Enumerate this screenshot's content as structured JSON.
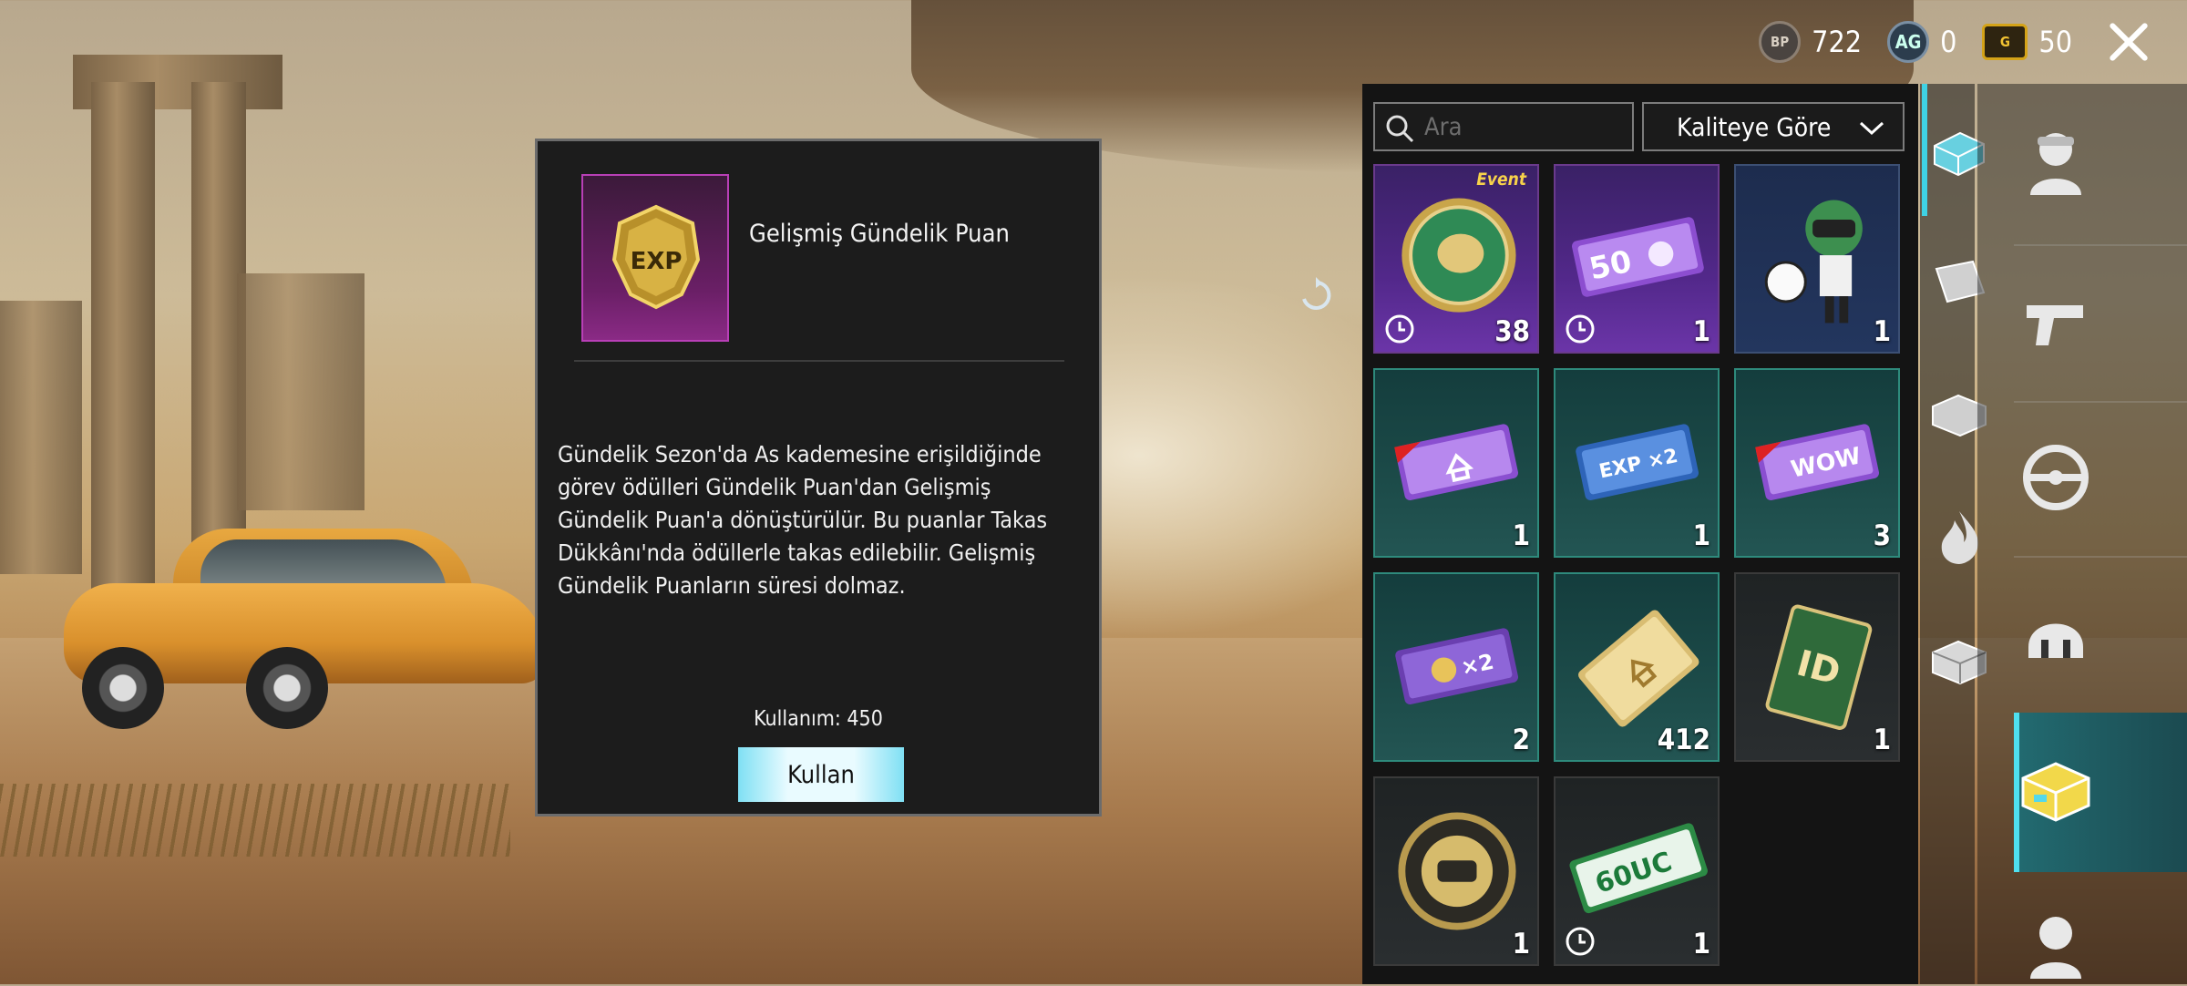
{
  "currency": {
    "bp_label": "BP",
    "bp_value": "722",
    "silver_label": "AG",
    "silver_value": "0",
    "gold_label": "G",
    "gold_value": "50"
  },
  "detail": {
    "title": "Gelişmiş Gündelik Puan",
    "icon_text": "EXP",
    "description": "Gündelik Sezon'da As kademesine erişildiğinde görev ödülleri Gündelik Puan'dan Gelişmiş Gündelik Puan'a dönüştürülür. Bu puanlar Takas Dükkânı'nda ödüllerle takas edilebilir. Gelişmiş Gündelik Puanların süresi dolmaz.",
    "usage": "Kullanım: 450",
    "use_button": "Kullan"
  },
  "inventory": {
    "search_placeholder": "Ara",
    "sort_label": "Kaliteye Göre",
    "items": [
      {
        "name": "event-coin",
        "qty": "38",
        "timed": true,
        "tag": "Event",
        "icon": "sheep-coin-icon"
      },
      {
        "name": "paw-voucher",
        "qty": "1",
        "timed": true,
        "icon_text": "50",
        "icon": "paw-voucher-icon"
      },
      {
        "name": "football-character",
        "qty": "1",
        "icon": "soccer-character-icon"
      },
      {
        "name": "home-card",
        "qty": "1",
        "icon": "home-card-icon"
      },
      {
        "name": "exp-x2-card",
        "qty": "1",
        "icon_text": "EXP ×2",
        "icon": "exp-card-icon"
      },
      {
        "name": "wow-card",
        "qty": "3",
        "icon_text": "WOW",
        "icon": "wow-card-icon"
      },
      {
        "name": "coin-x2-card",
        "qty": "2",
        "icon_text": "×2",
        "icon": "coin-card-icon"
      },
      {
        "name": "home-ticket",
        "qty": "412",
        "icon": "home-ticket-icon"
      },
      {
        "name": "id-card",
        "qty": "1",
        "icon_text": "ID",
        "icon": "id-card-icon"
      },
      {
        "name": "pubg-coin",
        "qty": "1",
        "icon": "pubg-coin-icon"
      },
      {
        "name": "uc-voucher",
        "qty": "1",
        "timed": true,
        "icon_text": "60UC",
        "icon": "uc-voucher-icon"
      }
    ]
  },
  "categories": [
    "chest-icon",
    "sale-tag-icon",
    "supply-crate-icon",
    "flame-icon",
    "box-icon"
  ],
  "categories2": [
    "character-icon",
    "pistol-icon",
    "steering-wheel-icon",
    "helmet-icon",
    "crate-active-icon",
    "avatar-icon"
  ]
}
